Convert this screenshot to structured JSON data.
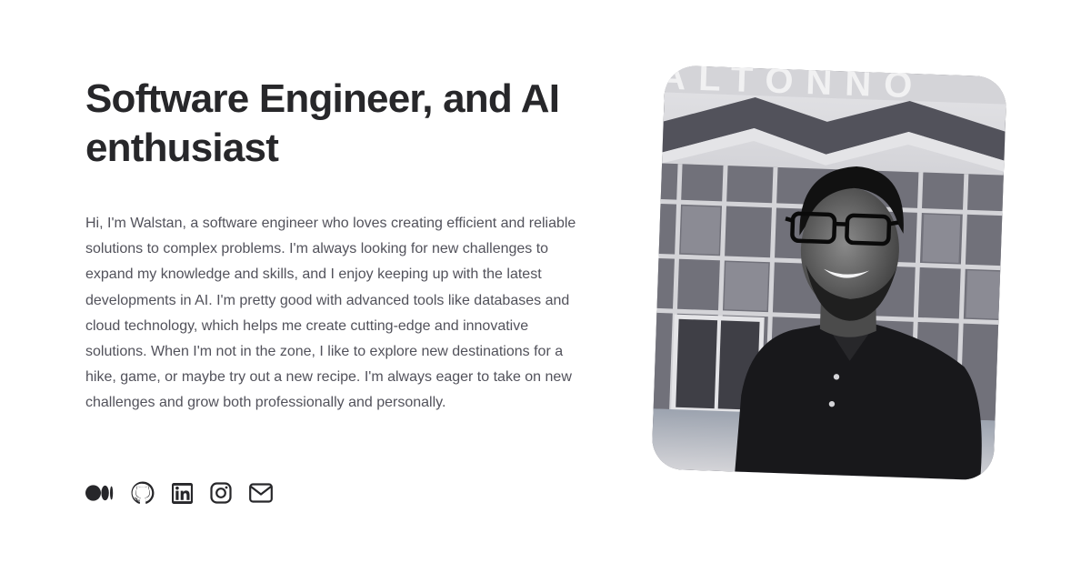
{
  "hero": {
    "headline": "Software Engineer, and AI enthusiast",
    "bio": "Hi, I'm Walstan, a software engineer who loves creating efficient and reliable solutions to complex problems. I'm always looking for new challenges to expand my knowledge and skills, and I enjoy keeping up with the latest developments in AI. I'm pretty good with advanced tools like databases and cloud technology, which helps me create cutting-edge and innovative solutions. When I'm not in the zone, I like to explore new destinations for a hike, game, or maybe try out a new recipe. I'm always eager to take on new challenges and grow both professionally and personally."
  },
  "socials": [
    {
      "icon": "medium-icon"
    },
    {
      "icon": "github-icon"
    },
    {
      "icon": "linkedin-icon"
    },
    {
      "icon": "instagram-icon"
    },
    {
      "icon": "mail-icon"
    }
  ],
  "portrait": {
    "style": "black-and-white",
    "sign_text": "ALTONNO"
  },
  "colors": {
    "heading": "#27272a",
    "body_text": "#52525b",
    "icon": "#27272a",
    "background": "#ffffff"
  }
}
